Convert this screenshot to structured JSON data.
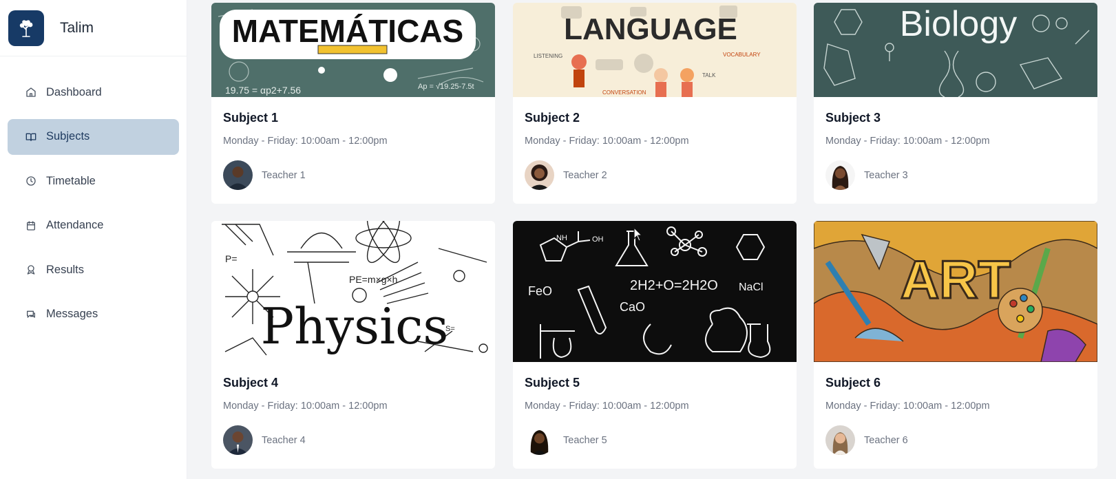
{
  "app": {
    "name": "Talim",
    "logo_icon": "tree-icon",
    "accent_color": "#173a66",
    "active_nav_bg": "#c1d1e0"
  },
  "sidebar": {
    "items": [
      {
        "label": "Dashboard",
        "icon": "home-icon",
        "active": false
      },
      {
        "label": "Subjects",
        "icon": "book-open-icon",
        "active": true
      },
      {
        "label": "Timetable",
        "icon": "clock-icon",
        "active": false
      },
      {
        "label": "Attendance",
        "icon": "calendar-icon",
        "active": false
      },
      {
        "label": "Results",
        "icon": "award-icon",
        "active": false
      },
      {
        "label": "Messages",
        "icon": "message-icon",
        "active": false
      }
    ]
  },
  "subjects": [
    {
      "title": "Subject 1",
      "schedule": "Monday - Friday: 10:00am - 12:00pm",
      "teacher": "Teacher 1",
      "image_text": "MATEMÁTICAS",
      "image_bg": "#4f6f6a"
    },
    {
      "title": "Subject 2",
      "schedule": "Monday - Friday: 10:00am - 12:00pm",
      "teacher": "Teacher 2",
      "image_text": "LANGUAGE",
      "image_bg": "#f7eed9"
    },
    {
      "title": "Subject 3",
      "schedule": "Monday - Friday: 10:00am - 12:00pm",
      "teacher": "Teacher 3",
      "image_text": "Biology",
      "image_bg": "#3e5a58"
    },
    {
      "title": "Subject 4",
      "schedule": "Monday - Friday: 10:00am - 12:00pm",
      "teacher": "Teacher 4",
      "image_text": "Physics",
      "image_bg": "#ffffff"
    },
    {
      "title": "Subject 5",
      "schedule": "Monday - Friday: 10:00am - 12:00pm",
      "teacher": "Teacher 5",
      "image_text": "2H2+O=2H2O",
      "image_bg": "#0d0d0d"
    },
    {
      "title": "Subject 6",
      "schedule": "Monday - Friday: 10:00am - 12:00pm",
      "teacher": "Teacher 6",
      "image_text": "ART",
      "image_bg": "#c78a3c"
    }
  ]
}
